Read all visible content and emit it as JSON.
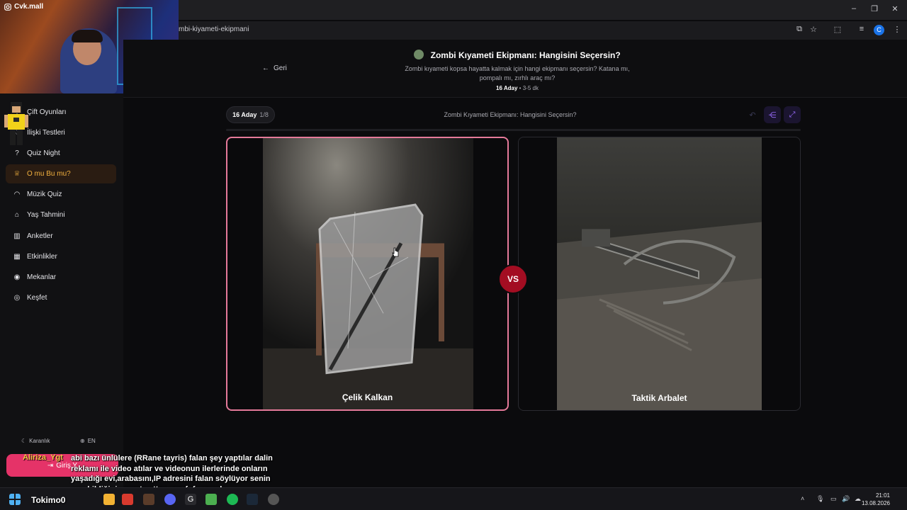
{
  "browser": {
    "url": "mbi-kiyameti-ekipmani",
    "profile_initial": "C"
  },
  "webcam": {
    "channel": "Cvk.mall"
  },
  "sidebar": {
    "items": [
      {
        "label": "Çift Oyunları",
        "icon": "heart-icon"
      },
      {
        "label": "İlişki Testleri",
        "icon": "heart-icon"
      },
      {
        "label": "Quiz Night",
        "icon": "question-icon"
      },
      {
        "label": "O mu Bu mu?",
        "icon": "trophy-icon",
        "active": true
      },
      {
        "label": "Müzik Quiz",
        "icon": "headphones-icon"
      },
      {
        "label": "Yaş Tahmini",
        "icon": "cake-icon"
      },
      {
        "label": "Anketler",
        "icon": "chart-icon"
      },
      {
        "label": "Etkinlikler",
        "icon": "calendar-icon"
      },
      {
        "label": "Mekanlar",
        "icon": "pin-icon"
      },
      {
        "label": "Keşfet",
        "icon": "compass-icon"
      }
    ],
    "theme_label": "Karanlık",
    "lang_label": "EN",
    "login_label": "Giriş Y"
  },
  "header": {
    "back_label": "Geri",
    "title": "Zombi Kıyameti Ekipmanı: Hangisini Seçersin?",
    "description": "Zombi kıyameti kopsa hayatta kalmak için hangi ekipmanı seçersin? Katana mı, pompalı mı, zırhlı araç mı?",
    "candidates": "16 Aday",
    "duration": "3-5 dk"
  },
  "round": {
    "candidates": "16 Aday",
    "progress": "1/8",
    "title": "Zombi Kıyameti Ekipmanı: Hangisini Seçersin?",
    "progress_fraction": 0
  },
  "cards": [
    {
      "label": "Çelik Kalkan",
      "selected": true
    },
    {
      "label": "Taktik Arbalet",
      "selected": false
    }
  ],
  "vs_label": "VS",
  "chat": {
    "user": "Aliriza_Ygt",
    "message": "abi bazı ünlülere (RRane tayris) falan şey yaptılar dalin reklamı ile video atılar ve videonun ilerlerinde onların yaşadığı evi,arabasını,IP adresini falan söylüyor senin onu bildiğini sanıpta attım uwufufu yapak"
  },
  "overlay_name": "Tokimo0",
  "taskbar": {
    "time": "21:01",
    "date": "13.08.2026"
  },
  "colors": {
    "accent_pink": "#e53368",
    "vs_red": "#a30d22",
    "active_gold": "#f4b23f",
    "purple_btn": "#9b6cff"
  }
}
